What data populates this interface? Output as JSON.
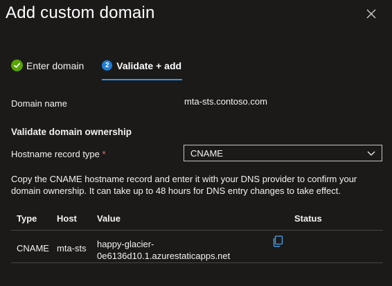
{
  "dialog": {
    "title": "Add custom domain"
  },
  "steps": [
    {
      "label": "Enter domain",
      "state": "completed",
      "icon": "checkmark-icon"
    },
    {
      "number": "2",
      "label": "Validate + add",
      "state": "active"
    }
  ],
  "form": {
    "domain_name_label": "Domain name",
    "domain_name_value": "mta-sts.contoso.com",
    "section_heading": "Validate domain ownership",
    "hostname_record_type_label": "Hostname record type",
    "required_marker": "*",
    "hostname_record_type_value": "CNAME",
    "instructions": "Copy the CNAME hostname record and enter it with your DNS provider to confirm your domain ownership. It can take up to 48 hours for DNS entry changes to take effect."
  },
  "table": {
    "headers": {
      "type": "Type",
      "host": "Host",
      "value": "Value",
      "status": "Status"
    },
    "rows": [
      {
        "type": "CNAME",
        "host": "mta-sts",
        "value_line1": "happy-glacier-",
        "value_line2": "0e6136d10.1.azurestaticapps.net",
        "status": "",
        "copy_icon": "copy-icon"
      }
    ]
  },
  "colors": {
    "background": "#1b1a19",
    "text": "#f3f2f1",
    "accent": "#2899f5",
    "success": "#57a300",
    "required": "#f1707b"
  }
}
